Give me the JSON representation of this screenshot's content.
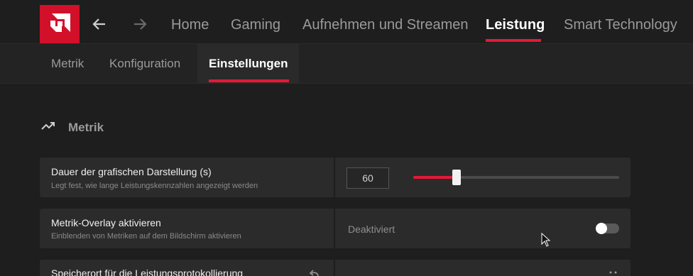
{
  "nav": {
    "back_icon": "arrow-left-icon",
    "forward_icon": "arrow-right-icon",
    "items": [
      {
        "label": "Home"
      },
      {
        "label": "Gaming"
      },
      {
        "label": "Aufnehmen und Streamen"
      },
      {
        "label": "Leistung"
      },
      {
        "label": "Smart Technology"
      }
    ],
    "active_index": 3
  },
  "subtabs": [
    {
      "label": "Metrik"
    },
    {
      "label": "Konfiguration"
    },
    {
      "label": "Einstellungen"
    }
  ],
  "active_subtab": 2,
  "section": {
    "title": "Metrik",
    "icon": "trending-up-icon"
  },
  "settings": [
    {
      "label": "Dauer der grafischen Darstellung (s)",
      "description": "Legt fest, wie lange Leistungskennzahlen angezeigt werden",
      "value": "60",
      "slider_fraction": 0.21
    },
    {
      "label": "Metrik-Overlay aktivieren",
      "description": "Einblenden von Metriken auf dem Bildschirm aktivieren",
      "state": "Deaktiviert",
      "enabled": false
    },
    {
      "label": "Speicherort für die Leistungsprotokollierung"
    }
  ],
  "colors": {
    "accent": "#e31937",
    "logo": "#d3102a",
    "background": "#1e1e1e",
    "panel": "#2b2b2b"
  }
}
